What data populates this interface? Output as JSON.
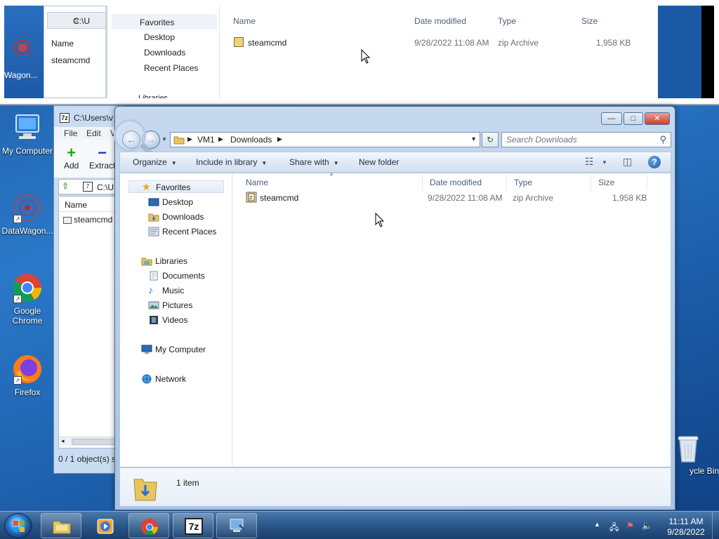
{
  "top_preview": {
    "left_label": "Wagon...",
    "small_window": {
      "address": "C:\\U",
      "column_name": "Name",
      "row": "steamcmd"
    },
    "nav": {
      "favorites": "Favorites",
      "desktop": "Desktop",
      "downloads": "Downloads",
      "recent": "Recent Places",
      "libraries": "Libraries"
    },
    "columns": {
      "name": "Name",
      "date": "Date modified",
      "type": "Type",
      "size": "Size"
    },
    "file": {
      "name": "steamcmd",
      "date": "9/28/2022 11:08 AM",
      "type": "zip Archive",
      "size": "1,958 KB"
    }
  },
  "desktop_icons": {
    "my_computer": "My Computer",
    "datawagon": "DataWagon...",
    "chrome_line1": "Google",
    "chrome_line2": "Chrome",
    "firefox": "Firefox",
    "recycle_bin": "ycle Bin"
  },
  "zip_window": {
    "title": "C:\\Users\\v",
    "menu": {
      "file": "File",
      "edit": "Edit",
      "view": "V"
    },
    "toolbar": {
      "add": "Add",
      "extract": "Extract"
    },
    "address": "C:\\U",
    "column_name": "Name",
    "row": "steamcmd",
    "status": "0 / 1 object(s) s"
  },
  "explorer": {
    "breadcrumb": {
      "root": "VM1",
      "current": "Downloads"
    },
    "search_placeholder": "Search Downloads",
    "commands": {
      "organize": "Organize",
      "include_in_library": "Include in library",
      "share_with": "Share with",
      "new_folder": "New folder"
    },
    "nav": {
      "favorites": "Favorites",
      "desktop": "Desktop",
      "downloads": "Downloads",
      "recent_places": "Recent Places",
      "libraries": "Libraries",
      "documents": "Documents",
      "music": "Music",
      "pictures": "Pictures",
      "videos": "Videos",
      "my_computer": "My Computer",
      "network": "Network"
    },
    "columns": {
      "name": "Name",
      "date": "Date modified",
      "type": "Type",
      "size": "Size"
    },
    "files": [
      {
        "name": "steamcmd",
        "date": "9/28/2022 11:08 AM",
        "type": "zip Archive",
        "size": "1,958 KB"
      }
    ],
    "details": {
      "count": "1 item"
    }
  },
  "taskbar": {
    "time": "11:11 AM",
    "date": "9/28/2022",
    "zip_label": "7z"
  },
  "colors": {
    "desktop": "#1f5fa8",
    "taskbar": "#2a5789",
    "selection": "#e3ecf6",
    "zip_icon": "#f5d36a"
  }
}
